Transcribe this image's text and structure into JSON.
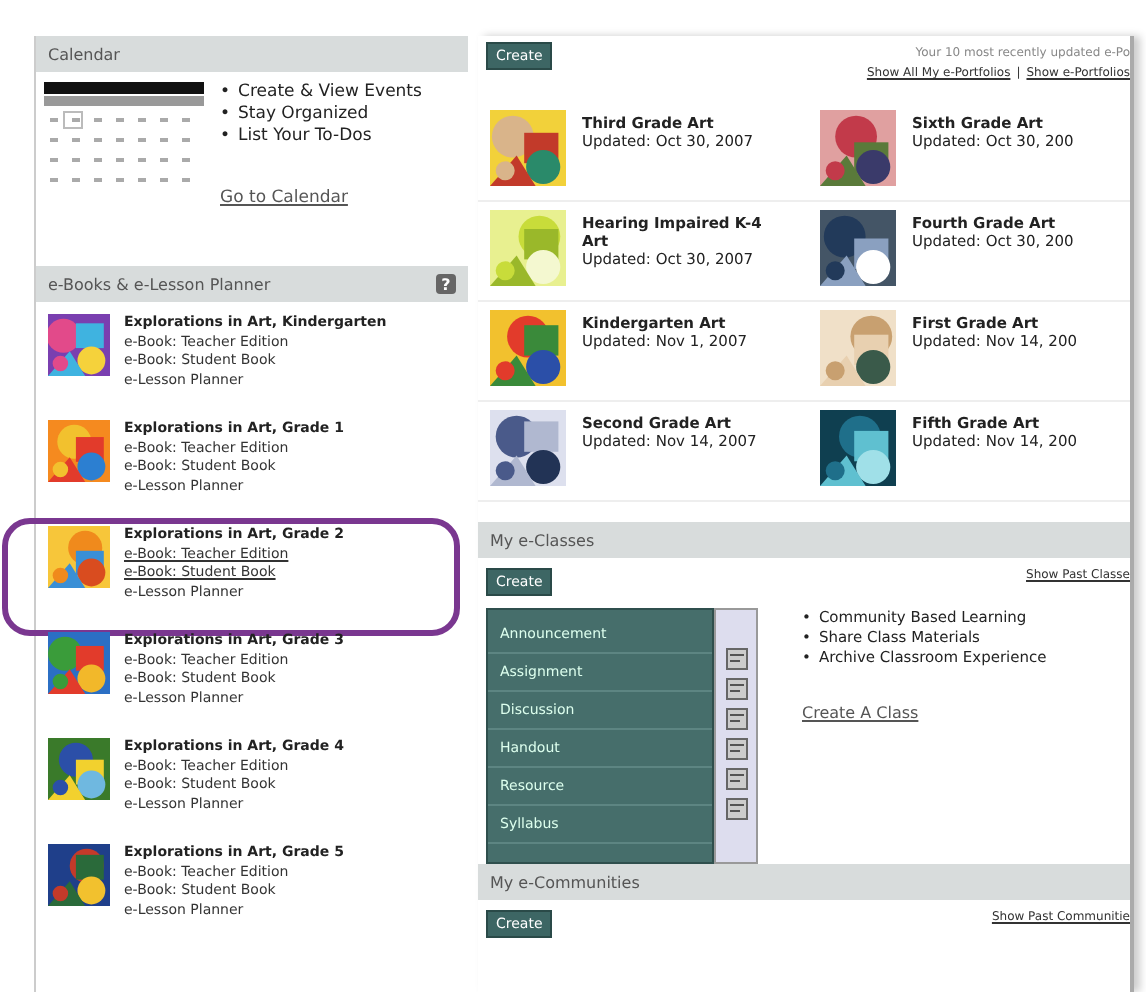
{
  "bullet": "•",
  "calendar": {
    "title": "Calendar",
    "features": [
      "Create & View Events",
      "Stay Organized",
      "List Your To-Dos"
    ],
    "link": "Go to Calendar"
  },
  "ebooks": {
    "title": "e-Books & e-Lesson Planner",
    "help": "?",
    "books": [
      {
        "title": "Explorations in Art, Kindergarten",
        "highlighted": false,
        "links": [
          {
            "label": "e-Book: Teacher Edition",
            "underlined": false
          },
          {
            "label": "e-Book: Student Book",
            "underlined": false
          },
          {
            "label": "e-Lesson Planner",
            "underlined": false
          }
        ]
      },
      {
        "title": "Explorations in Art, Grade 1",
        "highlighted": false,
        "links": [
          {
            "label": "e-Book: Teacher Edition",
            "underlined": false
          },
          {
            "label": "e-Book: Student Book",
            "underlined": false
          },
          {
            "label": "e-Lesson Planner",
            "underlined": false
          }
        ]
      },
      {
        "title": "Explorations in Art, Grade 2",
        "highlighted": true,
        "links": [
          {
            "label": "e-Book: Teacher Edition",
            "underlined": true
          },
          {
            "label": "e-Book: Student Book",
            "underlined": true
          },
          {
            "label": "e-Lesson Planner",
            "underlined": false
          }
        ]
      },
      {
        "title": "Explorations in Art, Grade 3",
        "highlighted": false,
        "links": [
          {
            "label": "e-Book: Teacher Edition",
            "underlined": false
          },
          {
            "label": "e-Book: Student Book",
            "underlined": false
          },
          {
            "label": "e-Lesson Planner",
            "underlined": false
          }
        ]
      },
      {
        "title": "Explorations in Art, Grade 4",
        "highlighted": false,
        "links": [
          {
            "label": "e-Book: Teacher Edition",
            "underlined": false
          },
          {
            "label": "e-Book: Student Book",
            "underlined": false
          },
          {
            "label": "e-Lesson Planner",
            "underlined": false
          }
        ]
      },
      {
        "title": "Explorations in Art, Grade 5",
        "highlighted": false,
        "links": [
          {
            "label": "e-Book: Teacher Edition",
            "underlined": false
          },
          {
            "label": "e-Book: Student Book",
            "underlined": false
          },
          {
            "label": "e-Lesson Planner",
            "underlined": false
          }
        ]
      }
    ]
  },
  "portfolios": {
    "create": "Create",
    "note": "Your 10 most recently updated e-Po",
    "links": [
      "Show All My e-Portfolios",
      "Show e-Portfolios"
    ],
    "separator": "|",
    "items": [
      {
        "title": "Third Grade Art",
        "updated": "Updated: Oct 30, 2007"
      },
      {
        "title": "Sixth Grade Art",
        "updated": "Updated: Oct 30, 200"
      },
      {
        "title": "Hearing Impaired K-4 Art",
        "updated": "Updated: Oct 30, 2007"
      },
      {
        "title": "Fourth Grade Art",
        "updated": "Updated: Oct 30, 200"
      },
      {
        "title": "Kindergarten Art",
        "updated": "Updated: Nov 1, 2007"
      },
      {
        "title": "First Grade Art",
        "updated": "Updated: Nov 14, 200"
      },
      {
        "title": "Second Grade Art",
        "updated": "Updated: Nov 14, 2007"
      },
      {
        "title": "Fifth Grade Art",
        "updated": "Updated: Nov 14, 200"
      }
    ]
  },
  "classes": {
    "title": "My e-Classes",
    "create": "Create",
    "past_link": "Show Past Classe",
    "menu": [
      "Announcement",
      "Assignment",
      "Discussion",
      "Handout",
      "Resource",
      "Syllabus"
    ],
    "features": [
      "Community Based Learning",
      "Share Class Materials",
      "Archive Classroom Experience"
    ],
    "link": "Create A Class"
  },
  "communities": {
    "title": "My e-Communities",
    "create": "Create",
    "past_link": "Show Past Communitie"
  }
}
